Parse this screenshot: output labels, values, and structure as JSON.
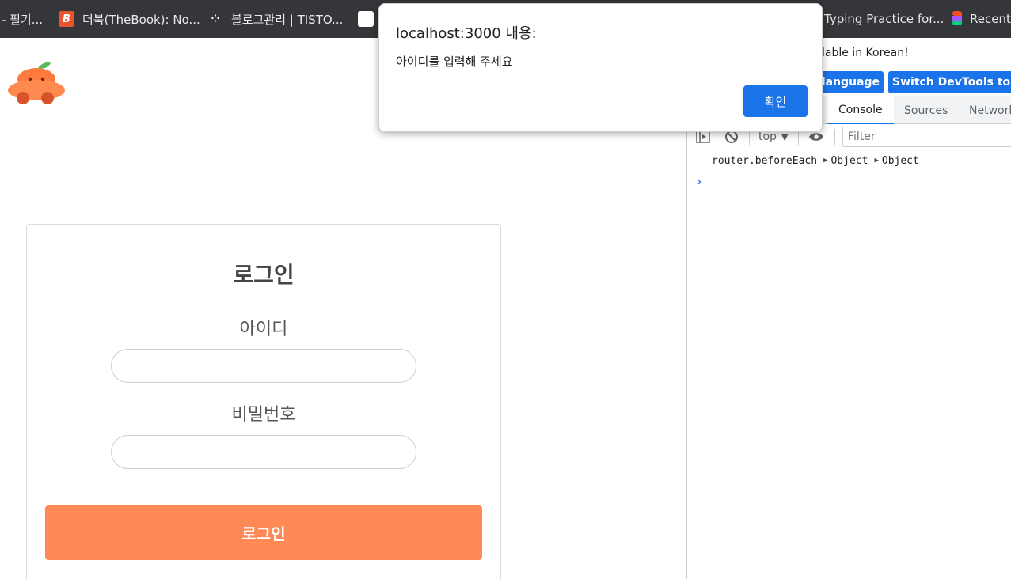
{
  "bookmarks": [
    {
      "label": "- 필기...",
      "icon": "none"
    },
    {
      "label": "더북(TheBook): No...",
      "icon": "thebook-icon"
    },
    {
      "label": "블로그관리 | TISTO...",
      "icon": "tistory-icon"
    },
    {
      "label": "Typing Practice for...",
      "icon": "typing-icon"
    },
    {
      "label": "Recent",
      "icon": "figma-icon"
    }
  ],
  "login": {
    "title": "로그인",
    "id_label": "아이디",
    "id_value": "",
    "password_label": "비밀번호",
    "password_value": "",
    "button_label": "로그인"
  },
  "devtools": {
    "lang_notice": "lable in Korean!",
    "lang_button_1": "s language",
    "lang_button_2": "Switch DevTools to Ko",
    "tabs": [
      "Console",
      "Sources",
      "Network"
    ],
    "active_tab": "Console",
    "context": "top",
    "filter_placeholder": "Filter",
    "console_log": {
      "text": "router.beforeEach",
      "arg1": "Object",
      "arg2": "Object"
    },
    "prompt": "›"
  },
  "alert": {
    "title": "localhost:3000 내용:",
    "message": "아이디를 입력해 주세요",
    "ok_label": "확인"
  },
  "colors": {
    "accent_orange": "#ff8a55",
    "chrome_blue": "#1a73e8",
    "bookmarks_bg": "#35363a"
  }
}
